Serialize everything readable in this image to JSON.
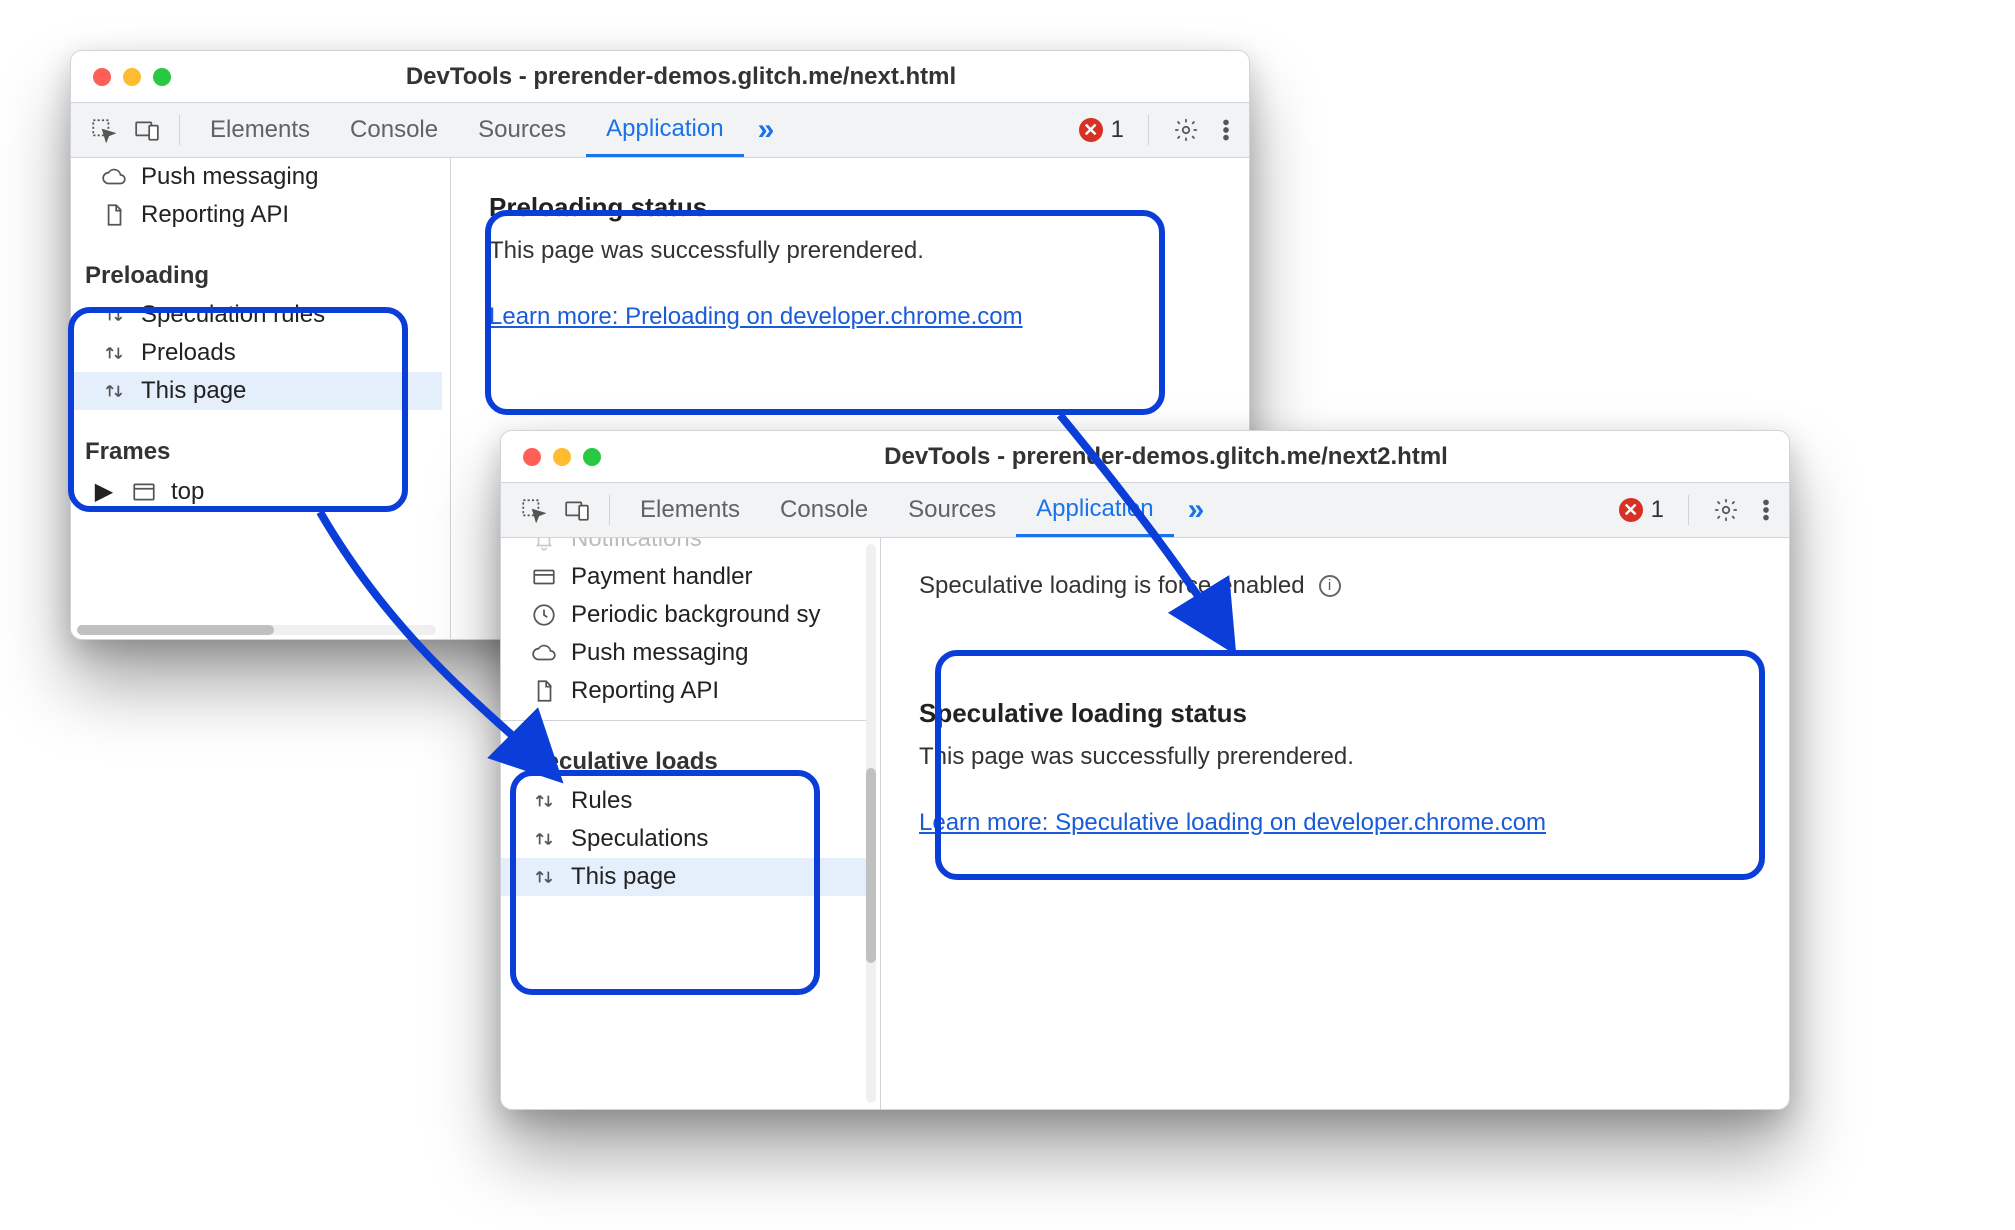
{
  "window1": {
    "title": "DevTools - prerender-demos.glitch.me/next.html",
    "tabs": [
      "Elements",
      "Console",
      "Sources",
      "Application"
    ],
    "activeTab": "Application",
    "error_count": "1",
    "sidebar_top": [
      "Push messaging",
      "Reporting API"
    ],
    "section": {
      "title": "Preloading",
      "items": [
        "Speculation rules",
        "Preloads",
        "This page"
      ],
      "selected": "This page"
    },
    "frames": {
      "title": "Frames",
      "items": [
        "top"
      ]
    },
    "panel": {
      "heading": "Preloading status",
      "body": "This page was successfully prerendered.",
      "link": "Learn more: Preloading on developer.chrome.com"
    }
  },
  "window2": {
    "title": "DevTools - prerender-demos.glitch.me/next2.html",
    "tabs": [
      "Elements",
      "Console",
      "Sources",
      "Application"
    ],
    "activeTab": "Application",
    "error_count": "1",
    "sidebar_top": [
      "Notifications",
      "Payment handler",
      "Periodic background sy",
      "Push messaging",
      "Reporting API"
    ],
    "section": {
      "title": "Speculative loads",
      "items": [
        "Rules",
        "Speculations",
        "This page"
      ],
      "selected": "This page"
    },
    "banner": "Speculative loading is force-enabled",
    "panel": {
      "heading": "Speculative loading status",
      "body": "This page was successfully prerendered.",
      "link": "Learn more: Speculative loading on developer.chrome.com"
    }
  }
}
